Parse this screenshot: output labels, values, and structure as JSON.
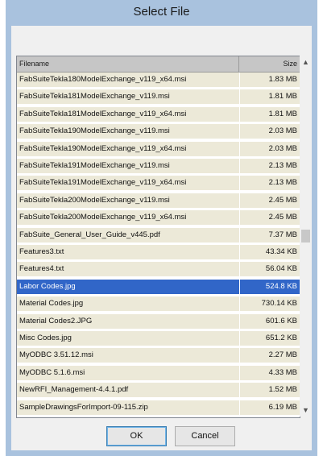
{
  "dialog": {
    "title": "Select File"
  },
  "table": {
    "columns": [
      "Filename",
      "Size"
    ],
    "rows": [
      {
        "name": "FabSuiteTekla180ModelExchange_v119_x64.msi",
        "size": "1.83 MB"
      },
      {
        "name": "FabSuiteTekla181ModelExchange_v119.msi",
        "size": "1.81 MB"
      },
      {
        "name": "FabSuiteTekla181ModelExchange_v119_x64.msi",
        "size": "1.81 MB"
      },
      {
        "name": "FabSuiteTekla190ModelExchange_v119.msi",
        "size": "2.03 MB"
      },
      {
        "name": "FabSuiteTekla190ModelExchange_v119_x64.msi",
        "size": "2.03 MB"
      },
      {
        "name": "FabSuiteTekla191ModelExchange_v119.msi",
        "size": "2.13 MB"
      },
      {
        "name": "FabSuiteTekla191ModelExchange_v119_x64.msi",
        "size": "2.13 MB"
      },
      {
        "name": "FabSuiteTekla200ModelExchange_v119.msi",
        "size": "2.45 MB"
      },
      {
        "name": "FabSuiteTekla200ModelExchange_v119_x64.msi",
        "size": "2.45 MB"
      },
      {
        "name": "FabSuite_General_User_Guide_v445.pdf",
        "size": "7.37 MB"
      },
      {
        "name": "Features3.txt",
        "size": "43.34 KB"
      },
      {
        "name": "Features4.txt",
        "size": "56.04 KB"
      },
      {
        "name": "Labor Codes.jpg",
        "size": "524.8 KB",
        "selected": true
      },
      {
        "name": "Material Codes.jpg",
        "size": "730.14 KB"
      },
      {
        "name": "Material Codes2.JPG",
        "size": "601.6 KB"
      },
      {
        "name": "Misc Codes.jpg",
        "size": "651.2 KB"
      },
      {
        "name": "MyODBC 3.51.12.msi",
        "size": "2.27 MB"
      },
      {
        "name": "MyODBC 5.1.6.msi",
        "size": "4.33 MB"
      },
      {
        "name": "NewRFI_Management-4.4.1.pdf",
        "size": "1.52 MB"
      },
      {
        "name": "SampleDrawingsForImport-09-115.zip",
        "size": "6.19 MB"
      }
    ]
  },
  "scrollbar": {
    "up_icon": "chevron-up-icon",
    "down_icon": "chevron-down-icon"
  },
  "buttons": {
    "ok": "OK",
    "cancel": "Cancel"
  }
}
